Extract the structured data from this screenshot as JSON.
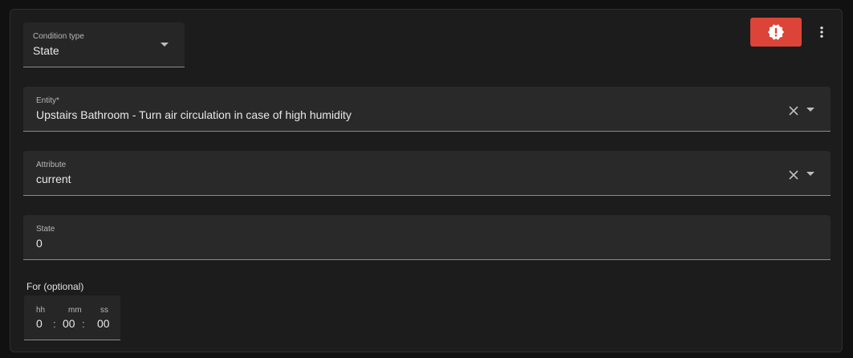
{
  "condition_type": {
    "label": "Condition type",
    "value": "State"
  },
  "entity": {
    "label": "Entity*",
    "value": "Upstairs Bathroom - Turn air circulation in case of high humidity"
  },
  "attribute": {
    "label": "Attribute",
    "value": "current"
  },
  "state": {
    "label": "State",
    "value": "0"
  },
  "for_duration": {
    "label": "For (optional)",
    "hours_label": "hh",
    "minutes_label": "mm",
    "seconds_label": "ss",
    "hours": "0",
    "minutes": "00",
    "seconds": "00",
    "separator": ":"
  },
  "icons": {
    "alert": "alert-decagram-icon",
    "menu": "dots-vertical-icon",
    "clear": "close-icon",
    "dropdown": "menu-down-icon"
  },
  "colors": {
    "alert_button": "#db4437",
    "card_background": "#1c1c1c",
    "field_background": "#292929"
  }
}
